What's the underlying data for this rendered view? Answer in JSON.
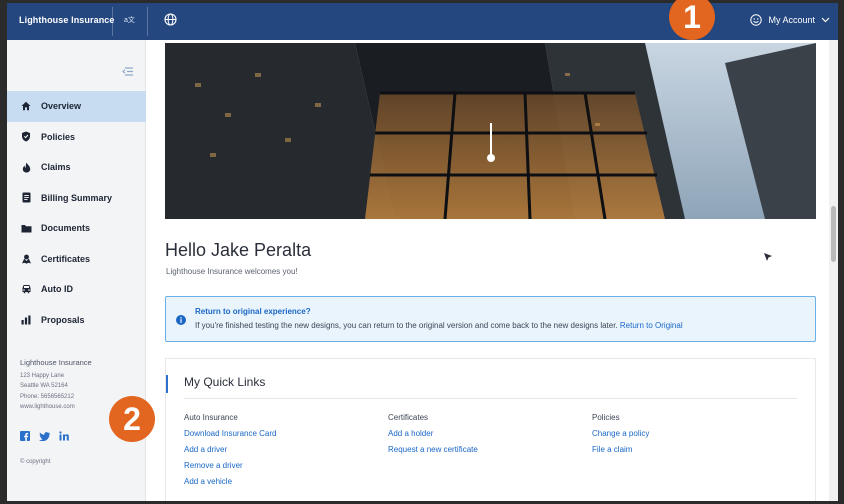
{
  "header": {
    "brand": "Lighthouse Insurance",
    "account_label": "My Account"
  },
  "sidebar": {
    "items": [
      {
        "label": "Overview",
        "icon": "home-icon"
      },
      {
        "label": "Policies",
        "icon": "shield-icon"
      },
      {
        "label": "Claims",
        "icon": "fire-icon"
      },
      {
        "label": "Billing Summary",
        "icon": "receipt-icon"
      },
      {
        "label": "Documents",
        "icon": "folder-icon"
      },
      {
        "label": "Certificates",
        "icon": "certificate-icon"
      },
      {
        "label": "Auto ID",
        "icon": "car-icon"
      },
      {
        "label": "Proposals",
        "icon": "chart-icon"
      }
    ],
    "address": {
      "name": "Lighthouse Insurance",
      "street": "123 Happy Lane",
      "city": "Seattle WA 52164",
      "phone": "Phone: 5656565212",
      "web": "www.lighthouse.com"
    },
    "copyright": "© copyright"
  },
  "main": {
    "hello": "Hello Jake Peralta",
    "welcome": "Lighthouse Insurance welcomes you!",
    "banner": {
      "title": "Return to original experience?",
      "body": "If you're finished testing the new designs, you can return to the original version and come back to the new designs later.",
      "link": "Return to Original"
    },
    "quick_links": {
      "title": "My Quick Links",
      "columns": [
        {
          "header": "Auto Insurance",
          "links": [
            "Download Insurance Card",
            "Add a driver",
            "Remove a driver",
            "Add a vehicle"
          ]
        },
        {
          "header": "Certificates",
          "links": [
            "Add a holder",
            "Request a new certificate"
          ]
        },
        {
          "header": "Policies",
          "links": [
            "Change a policy",
            "File a claim"
          ]
        }
      ]
    }
  },
  "annotations": {
    "badge1": "1",
    "badge2": "2"
  },
  "colors": {
    "topbar": "#24477f",
    "accent": "#1a67c6",
    "active_nav": "#c7dcf1",
    "badge": "#e2661f"
  }
}
